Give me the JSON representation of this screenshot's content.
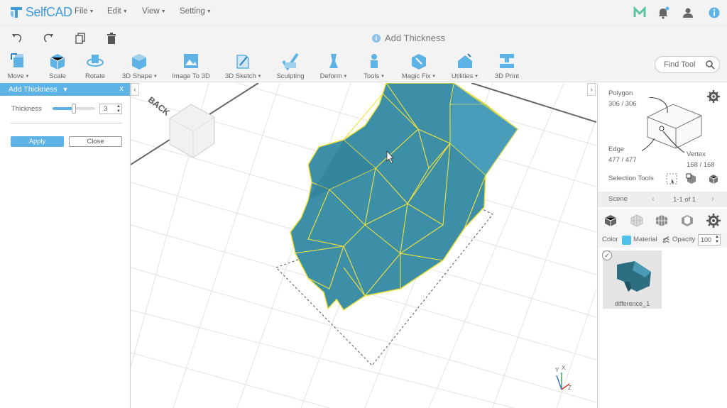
{
  "app": {
    "name": "SelfCAD",
    "brand_color": "#3d9bd6"
  },
  "menu": [
    {
      "label": "File"
    },
    {
      "label": "Edit"
    },
    {
      "label": "View"
    },
    {
      "label": "Setting"
    }
  ],
  "topbar_icons": [
    "m-logo-icon",
    "bell-icon",
    "user-icon",
    "info-icon"
  ],
  "subbar": {
    "title": "Add Thickness",
    "icons": [
      "undo-icon",
      "redo-icon",
      "copy-icon",
      "delete-icon"
    ]
  },
  "toolbar": {
    "tools": [
      {
        "label": "Move",
        "dropdown": true
      },
      {
        "label": "Scale",
        "dropdown": false
      },
      {
        "label": "Rotate",
        "dropdown": false
      },
      {
        "label": "3D Shape",
        "dropdown": true
      },
      {
        "label": "Image To 3D",
        "dropdown": false
      },
      {
        "label": "3D Sketch",
        "dropdown": true
      },
      {
        "label": "Sculpting",
        "dropdown": false
      },
      {
        "label": "Deform",
        "dropdown": true
      },
      {
        "label": "Tools",
        "dropdown": true
      },
      {
        "label": "Magic Fix",
        "dropdown": true
      },
      {
        "label": "Utilities",
        "dropdown": true
      },
      {
        "label": "3D Print",
        "dropdown": false
      }
    ],
    "find_tool": {
      "placeholder": "Find Tool"
    }
  },
  "left_panel": {
    "header": "Add Thickness",
    "close": "x",
    "thickness_label": "Thickness",
    "thickness_value": "3",
    "slider_level": 0.5,
    "apply_label": "Apply",
    "close_label": "Close"
  },
  "viewport": {
    "view_cube_label": "BACK",
    "axis_labels": {
      "x": "X",
      "y": "Y",
      "z": "Z"
    }
  },
  "right_panel": {
    "polygon_label": "Polygon",
    "polygon_count": "306 / 306",
    "edge_label": "Edge",
    "edge_count": "477 / 477",
    "vertex_label": "Vertex",
    "vertex_count": "168 / 168",
    "selection_tools_label": "Selection Tools",
    "scene_label": "Scene",
    "scene_pager": "1-1 of 1",
    "color_label": "Color",
    "color_value": "#4fc1e9",
    "material_label": "Material",
    "opacity_label": "Opacity",
    "opacity_value": "100",
    "object_name": "difference_1"
  },
  "colors": {
    "accent": "#5db2e6",
    "mesh_fill": "#3d8fa8",
    "mesh_edges": "#f2e33b"
  }
}
